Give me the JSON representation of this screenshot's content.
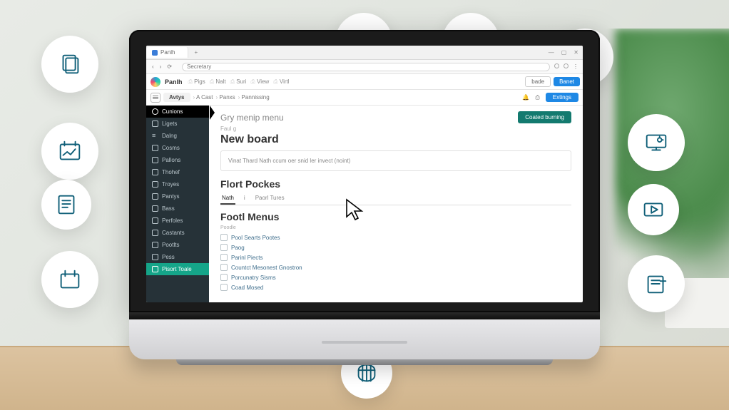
{
  "browser": {
    "tab_title": "Panlh",
    "address": "Secretary"
  },
  "toolbar": {
    "brand": "Panlh",
    "links": [
      "Pigs",
      "Nalt",
      "Suri",
      "View",
      "Virtl"
    ],
    "btn_outline": "bade",
    "btn_primary": "Banet"
  },
  "subbar": {
    "chip": "Avtys",
    "crumbs": [
      "A Cast",
      "Panxs",
      "Pannissing"
    ],
    "pill": "Extings"
  },
  "sidebar": {
    "items": [
      {
        "label": "Cunions",
        "icon": "circle",
        "active": true
      },
      {
        "label": "Ligets",
        "icon": "sq"
      },
      {
        "label": "Dalng",
        "icon": "bars"
      },
      {
        "label": "Cosms",
        "icon": "sq"
      },
      {
        "label": "Pallons",
        "icon": "sq"
      },
      {
        "label": "Thohef",
        "icon": "sq"
      },
      {
        "label": "Troyes",
        "icon": "sq"
      },
      {
        "label": "Pantys",
        "icon": "sq"
      },
      {
        "label": "Bass",
        "icon": "sq"
      },
      {
        "label": "Perfoles",
        "icon": "sq"
      },
      {
        "label": "Castants",
        "icon": "sq"
      },
      {
        "label": "Pootlts",
        "icon": "sq"
      },
      {
        "label": "Pess",
        "icon": "sq"
      },
      {
        "label": "Pisort Toale",
        "icon": "sq",
        "special": true
      }
    ]
  },
  "main": {
    "sub_heading": "Gry menip menu",
    "hint": "Faul g",
    "title": "New board",
    "desc": "Vinat Thard Nath ccum oer snid ler invect (noint)",
    "cta": "Coated burning",
    "section": "Flort Pockes",
    "tabs": [
      "Nath",
      "i",
      "Paorl Tures"
    ],
    "tab_active": 0,
    "section2": "Footl Menus",
    "label_small": "Poodle",
    "checks": [
      "Pool Searts Pootes",
      "Paog",
      "Parinl Piects",
      "Countct Mesonest Gnostron",
      "Porcunatry Sisms",
      "Coad Mosed"
    ]
  },
  "badges": {
    "b1": "stacked-docs-icon",
    "b2": "calendar-chart-icon",
    "b3": "document-lines-icon",
    "b4": "calendar-blank-icon",
    "b5": "page-cursor-icon",
    "b6": "layout-columns-icon",
    "b7": "bookmark-doc-icon",
    "b8": "monitor-gauge-icon",
    "b9": "play-rect-icon",
    "b10": "note-plus-icon",
    "b11": "table-icon"
  }
}
